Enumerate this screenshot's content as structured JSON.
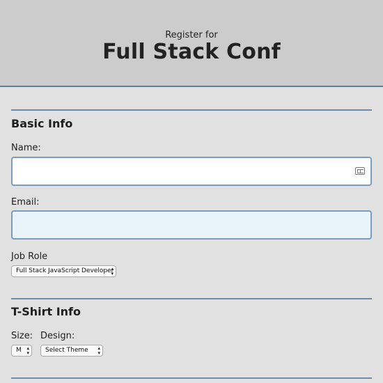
{
  "header": {
    "subtitle": "Register for",
    "title": "Full Stack Conf"
  },
  "basic_info": {
    "heading": "Basic Info",
    "name_label": "Name:",
    "name_value": "",
    "email_label": "Email:",
    "email_value": "",
    "job_role_label": "Job Role",
    "job_role_selected": "Full Stack JavaScript Developer"
  },
  "tshirt_info": {
    "heading": "T-Shirt Info",
    "size_label": "Size:",
    "size_selected": "M",
    "design_label": "Design:",
    "design_selected": "Select Theme"
  },
  "icons": {
    "name_field_icon": "contact-card-icon",
    "select_icon": "chevron-up-down-icon"
  },
  "colors": {
    "page_background": "#e1e1e1",
    "header_background": "#cccccc",
    "accent_rule": "#6f8ba6",
    "input_border": "#7b9cbc",
    "email_input_background": "#e8f3fa"
  }
}
